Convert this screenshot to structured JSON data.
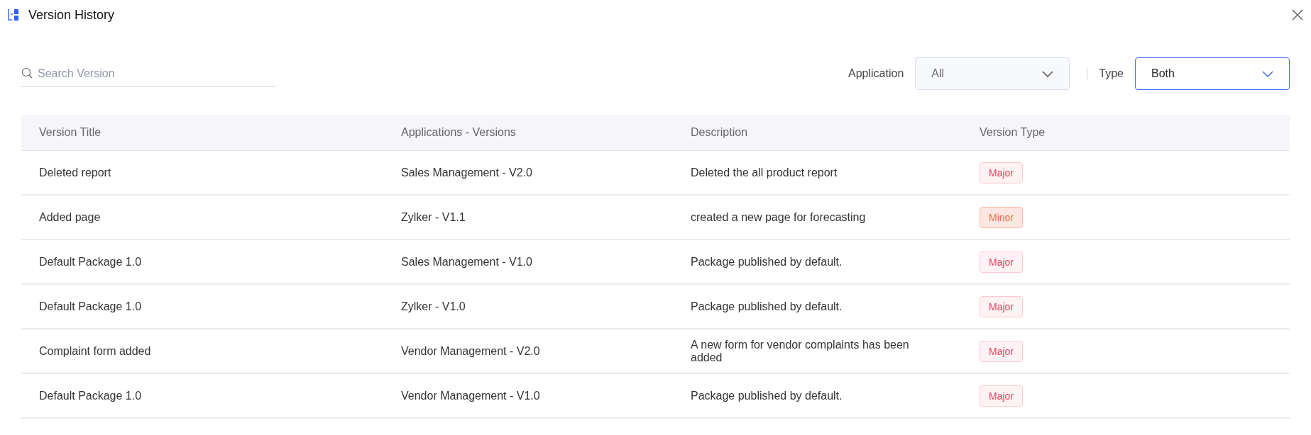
{
  "window": {
    "title": "Version History"
  },
  "search": {
    "placeholder": "Search Version"
  },
  "filters": [
    {
      "label": "Application",
      "value": "All",
      "focused": false
    },
    {
      "label": "Type",
      "value": "Both",
      "focused": true
    }
  ],
  "table": {
    "columns": [
      "Version Title",
      "Applications - Versions",
      "Description",
      "Version Type"
    ],
    "rows": [
      {
        "title": "Deleted report",
        "application": "Sales Management - V2.0",
        "description": "Deleted the all product report",
        "type": {
          "label": "Major",
          "kind": "major"
        }
      },
      {
        "title": "Added page",
        "application": "Zylker - V1.1",
        "description": "created a new page for forecasting",
        "type": {
          "label": "Minor",
          "kind": "minor"
        }
      },
      {
        "title": "Default Package 1.0",
        "application": "Sales Management - V1.0",
        "description": "Package published by default.",
        "type": {
          "label": "Major",
          "kind": "major"
        }
      },
      {
        "title": "Default Package 1.0",
        "application": "Zylker - V1.0",
        "description": "Package published by default.",
        "type": {
          "label": "Major",
          "kind": "major"
        }
      },
      {
        "title": "Complaint form added",
        "application": "Vendor Management - V2.0",
        "description": "A new form for vendor complaints has been added",
        "type": {
          "label": "Major",
          "kind": "major"
        }
      },
      {
        "title": "Default Package 1.0",
        "application": "Vendor Management - V1.0",
        "description": "Package published by default.",
        "type": {
          "label": "Major",
          "kind": "major"
        }
      }
    ]
  }
}
